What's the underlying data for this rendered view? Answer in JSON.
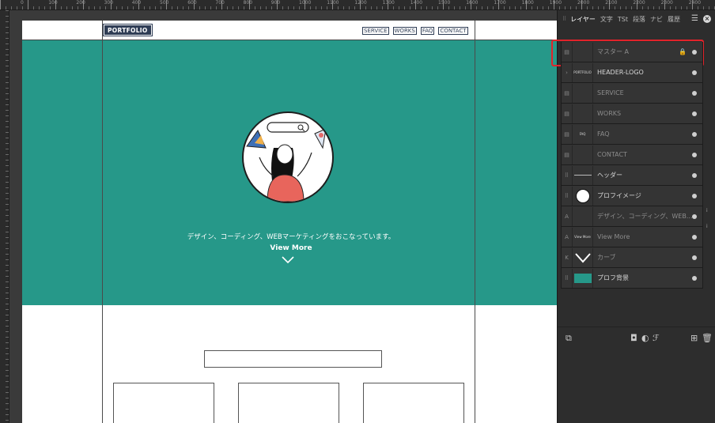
{
  "ruler": {
    "labels": [
      "0",
      "100",
      "200",
      "300",
      "400",
      "500",
      "600",
      "700",
      "800",
      "900",
      "1000",
      "1100",
      "1200",
      "1300",
      "1400",
      "1500",
      "1600",
      "1700",
      "1800",
      "1900",
      "2000",
      "2100",
      "2200",
      "2300",
      "2400"
    ]
  },
  "site": {
    "logo": "PORTFOLIO",
    "nav": [
      "SERVICE",
      "WORKS",
      "FAQ",
      "CONTACT"
    ],
    "hero_tagline": "デザイン、コーディング、WEBマーケティングをおこなっています。",
    "hero_cta": "View More",
    "colors": {
      "hero_bg": "#269889",
      "logo_bg": "#2f3d55"
    }
  },
  "panel": {
    "tabs": [
      "レイヤー",
      "文字",
      "TSt",
      "段落",
      "ナビ",
      "履歴"
    ],
    "menu_icon": "hamburger-icon",
    "close_icon": "close-icon",
    "layers": [
      {
        "label": "マスター A",
        "icon": "board-icon",
        "dim": true,
        "lock": true
      },
      {
        "label": "HEADER-LOGO",
        "icon": "expand-icon",
        "dim": false,
        "thumb": "PORTFOLIO"
      },
      {
        "label": "SERVICE",
        "icon": "board-icon",
        "dim": true
      },
      {
        "label": "WORKS",
        "icon": "board-icon",
        "dim": true
      },
      {
        "label": "FAQ",
        "icon": "board-icon",
        "dim": true,
        "thumb": "FAQ"
      },
      {
        "label": "CONTACT",
        "icon": "board-icon",
        "dim": true
      },
      {
        "label": "ヘッダー",
        "icon": "group-icon",
        "dim": false
      },
      {
        "label": "プロフイメージ",
        "icon": "group-icon",
        "dim": false
      },
      {
        "label": "デザイン、コーディング、WEB...",
        "icon": "text-icon",
        "dim": true
      },
      {
        "label": "View More",
        "icon": "text-icon",
        "dim": true,
        "thumb": "View More"
      },
      {
        "label": "カーブ",
        "icon": "curve-icon",
        "dim": true
      },
      {
        "label": "プロフ背景",
        "icon": "group-icon",
        "dim": false
      }
    ],
    "icon_glyphs": {
      "board": "▤",
      "expand": "›",
      "group": "⠿",
      "text": "A",
      "curve": "K"
    },
    "highlight_color": "#e2232a"
  }
}
